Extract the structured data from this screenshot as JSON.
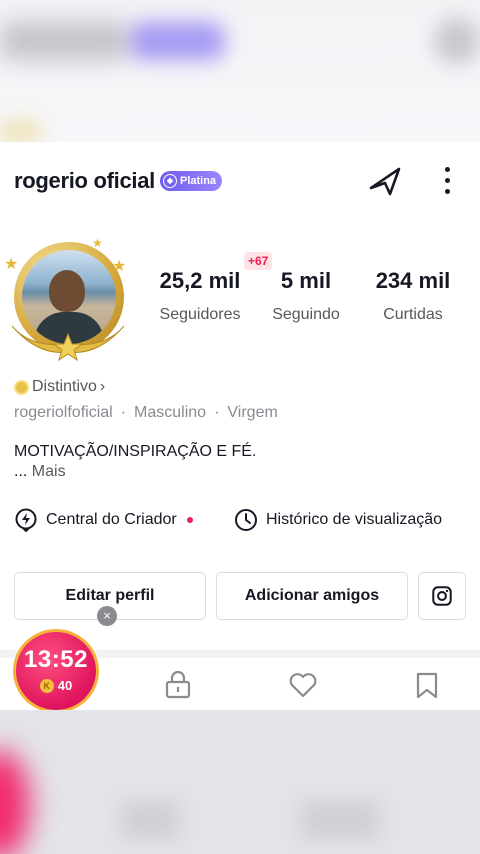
{
  "profile": {
    "name": "rogerio oficial",
    "tier_badge": "Platina",
    "username": "rogeriolfoficial",
    "gender": "Masculino",
    "sign": "Virgem",
    "separator": "·",
    "bio_line1": "MOTIVAÇÃO/INSPIRAÇÃO E FÉ.",
    "bio_ellipsis": "...",
    "bio_more": "Mais"
  },
  "badge_link": "Distintivo",
  "badge_chevron": "›",
  "stats": {
    "followers": {
      "value": "25,2 mil",
      "label": "Seguidores"
    },
    "following": {
      "value": "5 mil",
      "label": "Seguindo",
      "badge": "+67"
    },
    "likes": {
      "value": "234 mil",
      "label": "Curtidas"
    }
  },
  "links": {
    "creator_center": "Central do Criador",
    "view_history": "Histórico de visualização"
  },
  "buttons": {
    "edit_profile": "Editar perfil",
    "add_friends": "Adicionar amigos"
  },
  "close_glyph": "×",
  "timer": {
    "time": "13:52",
    "coin_icon": "K",
    "coins": "40"
  },
  "icons": {
    "share": "share-arrow-icon",
    "more": "more-vertical-icon",
    "instagram": "instagram-icon",
    "lock": "lock-icon",
    "heart": "heart-icon",
    "bookmark": "bookmark-icon",
    "creator": "lightning-icon",
    "history": "clock-icon"
  },
  "colors": {
    "accent_red": "#ee1d52",
    "tier_purple": "#6d5cf0",
    "gold": "#d4a63a"
  }
}
